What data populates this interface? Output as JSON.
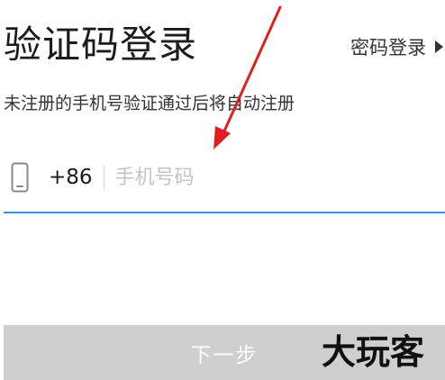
{
  "header": {
    "title": "验证码登录",
    "switch_label": "密码登录"
  },
  "subtitle": "未注册的手机号验证通过后将自动注册",
  "phone": {
    "country_code": "+86",
    "placeholder": "手机号码",
    "value": ""
  },
  "next_button": {
    "label": "下一步"
  },
  "watermark": {
    "text": "大玩客"
  },
  "icons": {
    "phone": "phone-icon",
    "switch_arrow": "triangle-right-icon"
  },
  "colors": {
    "underline": "#3c8fe0",
    "button_bg": "#cfcfcf",
    "button_text": "#ffffff",
    "annotation_arrow": "#e02020"
  }
}
